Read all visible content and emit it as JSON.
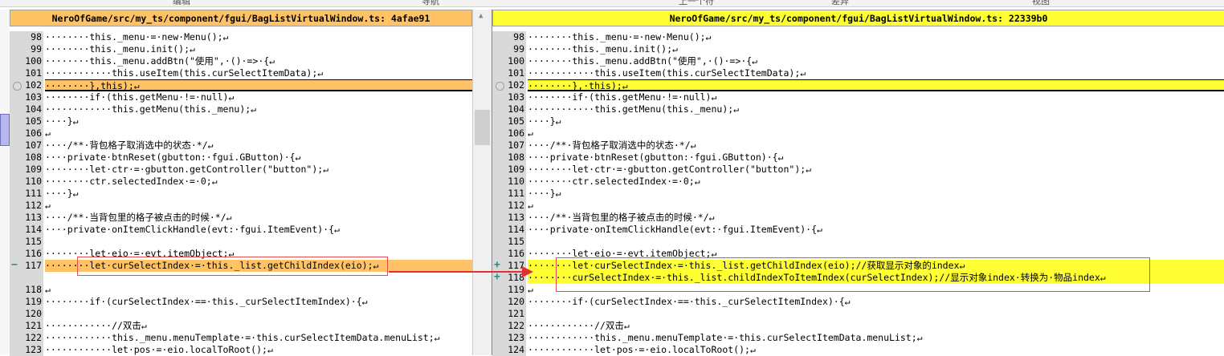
{
  "toolbar": {
    "items": [
      "编辑",
      "导航",
      "上一个符",
      "差异",
      "视图"
    ]
  },
  "left_pane": {
    "title": "NeroOfGame/src/my_ts/component/fgui/BagListVirtualWindow.ts: 4afae91",
    "lines": [
      {
        "num": "98",
        "text": "········this._menu·=·new·Menu();↵",
        "type": "normal"
      },
      {
        "num": "99",
        "text": "········this._menu.init();↵",
        "type": "normal"
      },
      {
        "num": "100",
        "text": "········this._menu.addBtn(\"使用\",·()·=>·{↵",
        "type": "normal"
      },
      {
        "num": "101",
        "text": "············this.useItem(this.curSelectItemData);↵",
        "type": "normal"
      },
      {
        "num": "102",
        "text": "········},this);↵",
        "type": "modsel"
      },
      {
        "num": "103",
        "text": "········if·(this.getMenu·!=·null)↵",
        "type": "normal"
      },
      {
        "num": "104",
        "text": "············this.getMenu(this._menu);↵",
        "type": "normal"
      },
      {
        "num": "105",
        "text": "····}↵",
        "type": "normal"
      },
      {
        "num": "106",
        "text": "↵",
        "type": "normal"
      },
      {
        "num": "107",
        "text": "····/**·背包格子取消选中的状态·*/↵",
        "type": "normal"
      },
      {
        "num": "108",
        "text": "····private·btnReset(gbutton:·fgui.GButton)·{↵",
        "type": "normal"
      },
      {
        "num": "109",
        "text": "········let·ctr·=·gbutton.getController(\"button\");↵",
        "type": "normal"
      },
      {
        "num": "110",
        "text": "········ctr.selectedIndex·=·0;↵",
        "type": "normal"
      },
      {
        "num": "111",
        "text": "····}↵",
        "type": "normal"
      },
      {
        "num": "112",
        "text": "↵",
        "type": "normal"
      },
      {
        "num": "113",
        "text": "····/**·当背包里的格子被点击的时候·*/↵",
        "type": "normal"
      },
      {
        "num": "114",
        "text": "····private·onItemClickHandle(evt:·fgui.ItemEvent)·{↵",
        "type": "normal"
      },
      {
        "num": "115",
        "text": "",
        "type": "normal"
      },
      {
        "num": "116",
        "text": "········let·eio·=·evt.itemObject;↵",
        "type": "normal"
      },
      {
        "num": "117",
        "text": "········let·curSelectIndex·=·this._list.getChildIndex(eio);↵",
        "type": "modsel",
        "marker": "−"
      },
      {
        "num": "",
        "text": "",
        "type": "blank"
      },
      {
        "num": "118",
        "text": "↵",
        "type": "normal"
      },
      {
        "num": "119",
        "text": "········if·(curSelectIndex·==·this._curSelectItemIndex)·{↵",
        "type": "normal"
      },
      {
        "num": "120",
        "text": "",
        "type": "normal"
      },
      {
        "num": "121",
        "text": "············//双击↵",
        "type": "normal"
      },
      {
        "num": "122",
        "text": "············this._menu.menuTemplate·=·this.curSelectItemData.menuList;↵",
        "type": "normal"
      },
      {
        "num": "123",
        "text": "············let·pos·=·eio.localToRoot();↵",
        "type": "normal"
      }
    ]
  },
  "right_pane": {
    "title": "NeroOfGame/src/my_ts/component/fgui/BagListVirtualWindow.ts: 22339b0",
    "lines": [
      {
        "num": "98",
        "text": "········this._menu·=·new·Menu();↵",
        "type": "normal"
      },
      {
        "num": "99",
        "text": "········this._menu.init();↵",
        "type": "normal"
      },
      {
        "num": "100",
        "text": "········this._menu.addBtn(\"使用\",·()·=>·{↵",
        "type": "normal"
      },
      {
        "num": "101",
        "text": "············this.useItem(this.curSelectItemData);↵",
        "type": "normal"
      },
      {
        "num": "102",
        "text": "········},·this);↵",
        "type": "modsel"
      },
      {
        "num": "103",
        "text": "········if·(this.getMenu·!=·null)↵",
        "type": "normal"
      },
      {
        "num": "104",
        "text": "············this.getMenu(this._menu);↵",
        "type": "normal"
      },
      {
        "num": "105",
        "text": "····}↵",
        "type": "normal"
      },
      {
        "num": "106",
        "text": "↵",
        "type": "normal"
      },
      {
        "num": "107",
        "text": "····/**·背包格子取消选中的状态·*/↵",
        "type": "normal"
      },
      {
        "num": "108",
        "text": "····private·btnReset(gbutton:·fgui.GButton)·{↵",
        "type": "normal"
      },
      {
        "num": "109",
        "text": "········let·ctr·=·gbutton.getController(\"button\");↵",
        "type": "normal"
      },
      {
        "num": "110",
        "text": "········ctr.selectedIndex·=·0;↵",
        "type": "normal"
      },
      {
        "num": "111",
        "text": "····}↵",
        "type": "normal"
      },
      {
        "num": "112",
        "text": "↵",
        "type": "normal"
      },
      {
        "num": "113",
        "text": "····/**·当背包里的格子被点击的时候·*/↵",
        "type": "normal"
      },
      {
        "num": "114",
        "text": "····private·onItemClickHandle(evt:·fgui.ItemEvent)·{↵",
        "type": "normal"
      },
      {
        "num": "115",
        "text": "",
        "type": "normal"
      },
      {
        "num": "116",
        "text": "········let·eio·=·evt.itemObject;↵",
        "type": "normal"
      },
      {
        "num": "117",
        "text": "········let·curSelectIndex·=·this._list.getChildIndex(eio);//获取显示对象的index↵",
        "type": "modsel",
        "marker": "+"
      },
      {
        "num": "118",
        "text": "········curSelectIndex·=·this._list.childIndexToItemIndex(curSelectIndex);//显示对象index·转换为·物品index↵",
        "type": "add",
        "marker": "+"
      },
      {
        "num": "119",
        "text": "↵",
        "type": "normal"
      },
      {
        "num": "120",
        "text": "········if·(curSelectIndex·==·this._curSelectItemIndex)·{↵",
        "type": "normal"
      },
      {
        "num": "121",
        "text": "",
        "type": "normal"
      },
      {
        "num": "122",
        "text": "············//双击↵",
        "type": "normal"
      },
      {
        "num": "123",
        "text": "············this._menu.menuTemplate·=·this.curSelectItemData.menuList;↵",
        "type": "normal"
      },
      {
        "num": "124",
        "text": "············let·pos·=·eio.localToRoot();↵",
        "type": "normal"
      }
    ]
  },
  "colors": {
    "left_header": "#ffc366",
    "right_header": "#ffff33",
    "gutter": "#d9d9d9",
    "selection": "#c8c8ef",
    "annotation_red": "#e03030"
  },
  "icons": {
    "removed_marker": "minus-icon",
    "added_marker": "plus-icon",
    "current_line": "circle-icon",
    "annotation": "red-arrow-icon"
  }
}
